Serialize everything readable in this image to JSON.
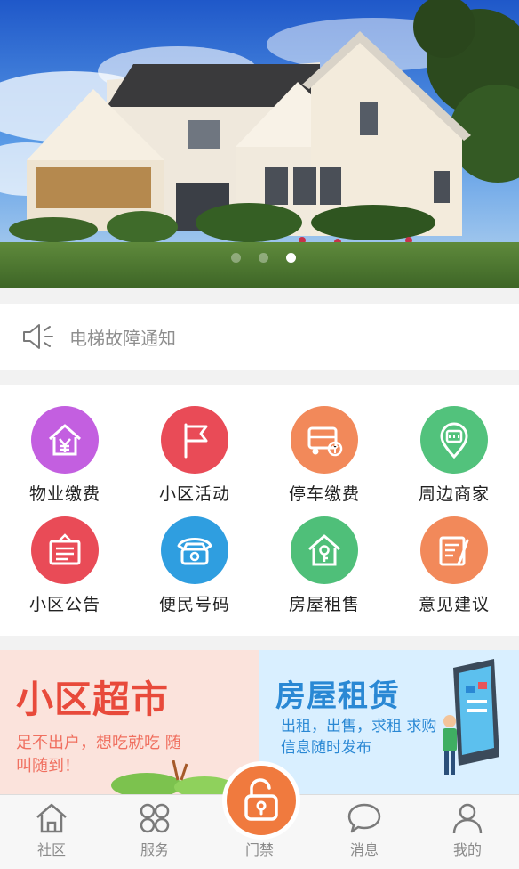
{
  "banner": {
    "image": "house-photo",
    "slides": 3,
    "active_slide": 3
  },
  "notice": {
    "icon": "speaker-icon",
    "text": "电梯故障通知"
  },
  "services": [
    {
      "label": "物业缴费",
      "icon": "house-yen-icon",
      "color": "#c35fe0"
    },
    {
      "label": "小区活动",
      "icon": "flag-icon",
      "color": "#e94b57"
    },
    {
      "label": "停车缴费",
      "icon": "truck-icon",
      "color": "#f2895a"
    },
    {
      "label": "周边商家",
      "icon": "shop-pin-icon",
      "color": "#52c27c"
    },
    {
      "label": "小区公告",
      "icon": "notice-board-icon",
      "color": "#e94b57"
    },
    {
      "label": "便民号码",
      "icon": "telephone-icon",
      "color": "#2f9ee0"
    },
    {
      "label": "房屋租售",
      "icon": "house-key-icon",
      "color": "#4fbf79"
    },
    {
      "label": "意见建议",
      "icon": "pen-note-icon",
      "color": "#f2895a"
    }
  ],
  "promo": {
    "supermarket": {
      "title": "小区超市",
      "subtitle": "足不出户，想吃就吃 随叫随到！"
    },
    "rental": {
      "title": "房屋租赁",
      "subtitle": "出租，出售，求租 求购信息随时发布"
    }
  },
  "tabbar": {
    "items": [
      {
        "label": "社区",
        "icon": "home-icon"
      },
      {
        "label": "服务",
        "icon": "services-icon"
      },
      {
        "label": "门禁",
        "icon": "unlock-icon"
      },
      {
        "label": "消息",
        "icon": "chat-bubble-icon"
      },
      {
        "label": "我的",
        "icon": "user-icon"
      }
    ],
    "accent": "#f07a3e"
  }
}
